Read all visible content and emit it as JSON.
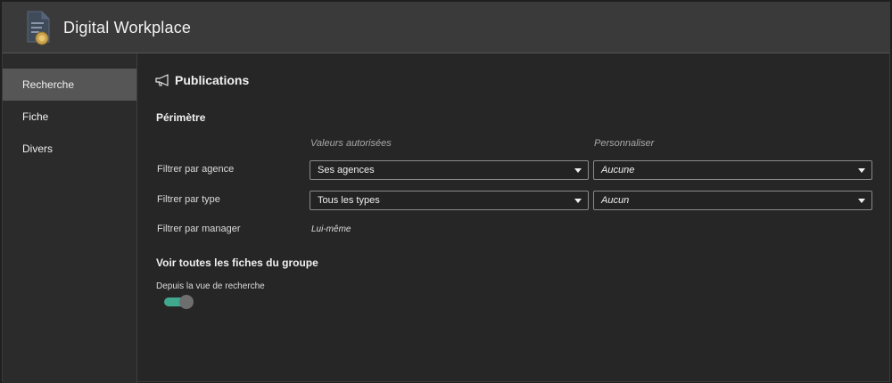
{
  "app": {
    "title": "Digital Workplace",
    "icon": "document-badge-icon"
  },
  "sidebar": {
    "items": [
      {
        "label": "Recherche",
        "active": true
      },
      {
        "label": "Fiche",
        "active": false
      },
      {
        "label": "Divers",
        "active": false
      }
    ]
  },
  "main": {
    "title": "Publications",
    "title_icon": "megaphone-icon",
    "perimetre": {
      "title": "Périmètre",
      "columns": [
        "Valeurs autorisées",
        "Personnaliser"
      ],
      "rows": [
        {
          "label": "Filtrer par agence",
          "value": "Ses agences",
          "custom": "Aucune"
        },
        {
          "label": "Filtrer par type",
          "value": "Tous les types",
          "custom": "Aucun"
        },
        {
          "label": "Filtrer par manager",
          "value": "Lui-même"
        }
      ]
    },
    "groupe": {
      "title": "Voir toutes les fiches du groupe",
      "toggle_label": "Depuis la vue de recherche",
      "toggle_on": true
    }
  },
  "colors": {
    "accent": "#3fa88e",
    "background": "#262626",
    "titlebar": "#3a3a3a",
    "sidebar_active": "#565656"
  }
}
